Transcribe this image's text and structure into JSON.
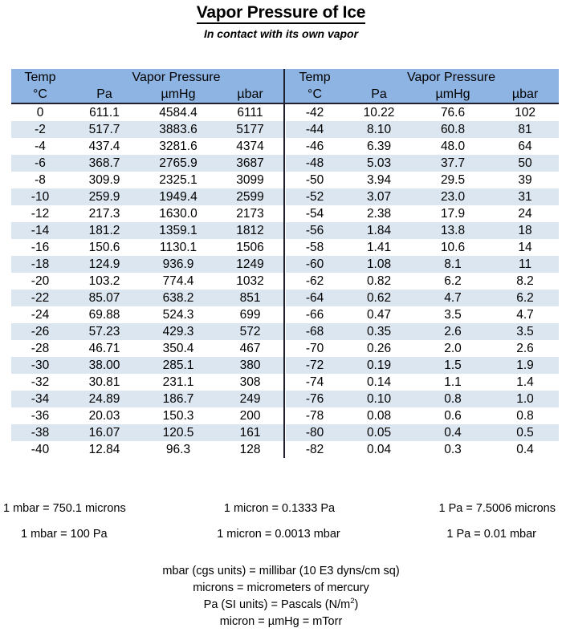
{
  "document": {
    "title": "Vapor Pressure of Ice",
    "subtitle": "In contact with its own vapor"
  },
  "table": {
    "header": {
      "temp_label": "Temp",
      "temp_unit": "°C",
      "group_label": "Vapor Pressure",
      "col_pa": "Pa",
      "col_umhg": "µmHg",
      "col_ubar": "µbar"
    },
    "columns": [
      "Temp °C",
      "Pa",
      "µmHg",
      "µbar"
    ],
    "left_rows": [
      [
        "0",
        "611.1",
        "4584.4",
        "6111"
      ],
      [
        "-2",
        "517.7",
        "3883.6",
        "5177"
      ],
      [
        "-4",
        "437.4",
        "3281.6",
        "4374"
      ],
      [
        "-6",
        "368.7",
        "2765.9",
        "3687"
      ],
      [
        "-8",
        "309.9",
        "2325.1",
        "3099"
      ],
      [
        "-10",
        "259.9",
        "1949.4",
        "2599"
      ],
      [
        "-12",
        "217.3",
        "1630.0",
        "2173"
      ],
      [
        "-14",
        "181.2",
        "1359.1",
        "1812"
      ],
      [
        "-16",
        "150.6",
        "1130.1",
        "1506"
      ],
      [
        "-18",
        "124.9",
        "936.9",
        "1249"
      ],
      [
        "-20",
        "103.2",
        "774.4",
        "1032"
      ],
      [
        "-22",
        "85.07",
        "638.2",
        "851"
      ],
      [
        "-24",
        "69.88",
        "524.3",
        "699"
      ],
      [
        "-26",
        "57.23",
        "429.3",
        "572"
      ],
      [
        "-28",
        "46.71",
        "350.4",
        "467"
      ],
      [
        "-30",
        "38.00",
        "285.1",
        "380"
      ],
      [
        "-32",
        "30.81",
        "231.1",
        "308"
      ],
      [
        "-34",
        "24.89",
        "186.7",
        "249"
      ],
      [
        "-36",
        "20.03",
        "150.3",
        "200"
      ],
      [
        "-38",
        "16.07",
        "120.5",
        "161"
      ],
      [
        "-40",
        "12.84",
        "96.3",
        "128"
      ]
    ],
    "right_rows": [
      [
        "-42",
        "10.22",
        "76.6",
        "102"
      ],
      [
        "-44",
        "8.10",
        "60.8",
        "81"
      ],
      [
        "-46",
        "6.39",
        "48.0",
        "64"
      ],
      [
        "-48",
        "5.03",
        "37.7",
        "50"
      ],
      [
        "-50",
        "3.94",
        "29.5",
        "39"
      ],
      [
        "-52",
        "3.07",
        "23.0",
        "31"
      ],
      [
        "-54",
        "2.38",
        "17.9",
        "24"
      ],
      [
        "-56",
        "1.84",
        "13.8",
        "18"
      ],
      [
        "-58",
        "1.41",
        "10.6",
        "14"
      ],
      [
        "-60",
        "1.08",
        "8.1",
        "11"
      ],
      [
        "-62",
        "0.82",
        "6.2",
        "8.2"
      ],
      [
        "-64",
        "0.62",
        "4.7",
        "6.2"
      ],
      [
        "-66",
        "0.47",
        "3.5",
        "4.7"
      ],
      [
        "-68",
        "0.35",
        "2.6",
        "3.5"
      ],
      [
        "-70",
        "0.26",
        "2.0",
        "2.6"
      ],
      [
        "-72",
        "0.19",
        "1.5",
        "1.9"
      ],
      [
        "-74",
        "0.14",
        "1.1",
        "1.4"
      ],
      [
        "-76",
        "0.10",
        "0.8",
        "1.0"
      ],
      [
        "-78",
        "0.08",
        "0.6",
        "0.8"
      ],
      [
        "-80",
        "0.05",
        "0.4",
        "0.5"
      ],
      [
        "-82",
        "0.04",
        "0.3",
        "0.4"
      ]
    ]
  },
  "conversions": {
    "row1": [
      "1 mbar = 750.1 microns",
      "1 micron = 0.1333 Pa",
      "1 Pa = 7.5006 microns"
    ],
    "row2": [
      "1 mbar = 100 Pa",
      "1 micron = 0.0013 mbar",
      "1 Pa = 0.01 mbar"
    ]
  },
  "definitions": {
    "line1": "mbar (cgs units) = millibar (10 E3 dyns/cm sq)",
    "line2": "microns = micrometers of mercury",
    "line3_prefix": "Pa (SI units) = Pascals (N/m",
    "line3_sup": "2",
    "line3_suffix": ")",
    "line4": "micron = µmHg = mTorr"
  },
  "colors": {
    "header_blue": "#8db4e2",
    "alt_row_blue": "#dce6f1",
    "rule_dark": "#1f1f2e"
  }
}
